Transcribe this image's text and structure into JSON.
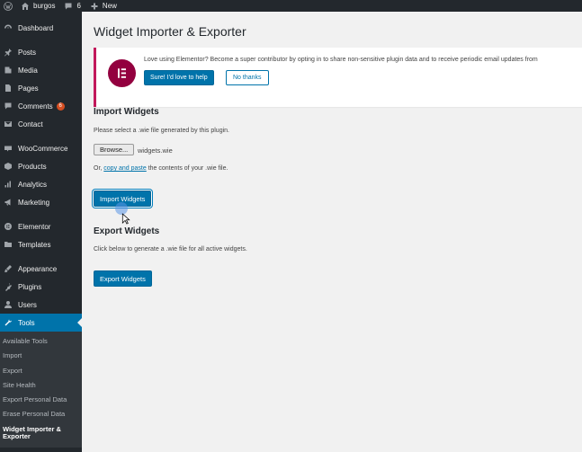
{
  "adminbar": {
    "site_name": "burgos",
    "comments_count": "6",
    "new_label": "New"
  },
  "sidebar": {
    "items": [
      {
        "label": "Dashboard",
        "icon": "dashboard-icon"
      },
      {
        "label": "Posts",
        "icon": "pin-icon"
      },
      {
        "label": "Media",
        "icon": "media-icon"
      },
      {
        "label": "Pages",
        "icon": "page-icon"
      },
      {
        "label": "Comments",
        "icon": "comment-icon",
        "badge": "6"
      },
      {
        "label": "Contact",
        "icon": "mail-icon"
      },
      {
        "label": "WooCommerce",
        "icon": "woo-icon"
      },
      {
        "label": "Products",
        "icon": "box-icon"
      },
      {
        "label": "Analytics",
        "icon": "bar-chart-icon"
      },
      {
        "label": "Marketing",
        "icon": "megaphone-icon"
      },
      {
        "label": "Elementor",
        "icon": "elementor-icon"
      },
      {
        "label": "Templates",
        "icon": "folder-icon"
      },
      {
        "label": "Appearance",
        "icon": "brush-icon"
      },
      {
        "label": "Plugins",
        "icon": "plug-icon"
      },
      {
        "label": "Users",
        "icon": "user-icon"
      },
      {
        "label": "Tools",
        "icon": "wrench-icon"
      }
    ],
    "submenu": [
      "Available Tools",
      "Import",
      "Export",
      "Site Health",
      "Export Personal Data",
      "Erase Personal Data",
      "Widget Importer & Exporter"
    ]
  },
  "main": {
    "title": "Widget Importer & Exporter",
    "notice": {
      "message": "Love using Elementor? Become a super contributor by opting in to share non-sensitive plugin data and to receive periodic email updates from",
      "primary_button": "Sure! I'd love to help",
      "secondary_button": "No thanks"
    },
    "import": {
      "heading": "Import Widgets",
      "instruction": "Please select a .wie file generated by this plugin.",
      "browse_label": "Browse...",
      "file_name": "widgets.wie",
      "alt_prefix": "Or, ",
      "alt_link": "copy and paste",
      "alt_suffix": " the contents of your .wie file.",
      "button": "Import Widgets"
    },
    "export": {
      "heading": "Export Widgets",
      "instruction": "Click below to generate a .wie file for all active widgets.",
      "button": "Export Widgets"
    }
  },
  "colors": {
    "admin_dark": "#23282d",
    "accent_blue": "#0073aa",
    "elementor_brand": "#93003f",
    "badge_orange": "#d54e21"
  }
}
